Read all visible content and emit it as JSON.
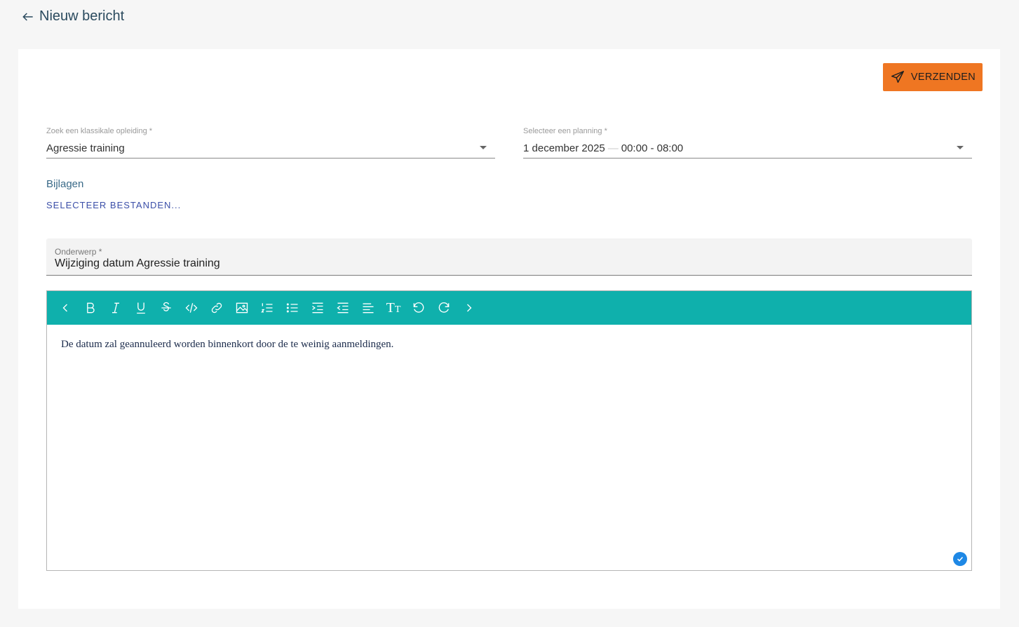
{
  "header": {
    "back_label": "Nieuw bericht"
  },
  "actions": {
    "send_label": "VERZENDEN"
  },
  "form": {
    "opleiding": {
      "label": "Zoek een klassikale opleiding *",
      "value": "Agressie training"
    },
    "planning": {
      "label": "Selecteer een planning *",
      "date": "1 december 2025",
      "separator": "—",
      "time": "00:00 - 08:00"
    },
    "attachments": {
      "label": "Bijlagen",
      "select_label": "SELECTEER BESTANDEN..."
    },
    "subject": {
      "label": "Onderwerp *",
      "value": "Wijziging datum Agressie training"
    },
    "editor": {
      "toolbar_icons": [
        "chevron-left",
        "bold",
        "italic",
        "underline",
        "strikethrough",
        "code",
        "link",
        "image",
        "ordered-list",
        "unordered-list",
        "indent",
        "outdent",
        "align-left",
        "text-size",
        "undo",
        "redo",
        "chevron-right"
      ],
      "content": "De datum zal geannuleerd worden binnenkort door de te weinig aanmeldingen."
    }
  },
  "colors": {
    "accent": "#ef7622",
    "toolbar": "#0fb0ac",
    "link": "#3b4fa8",
    "check": "#1e88e5"
  }
}
